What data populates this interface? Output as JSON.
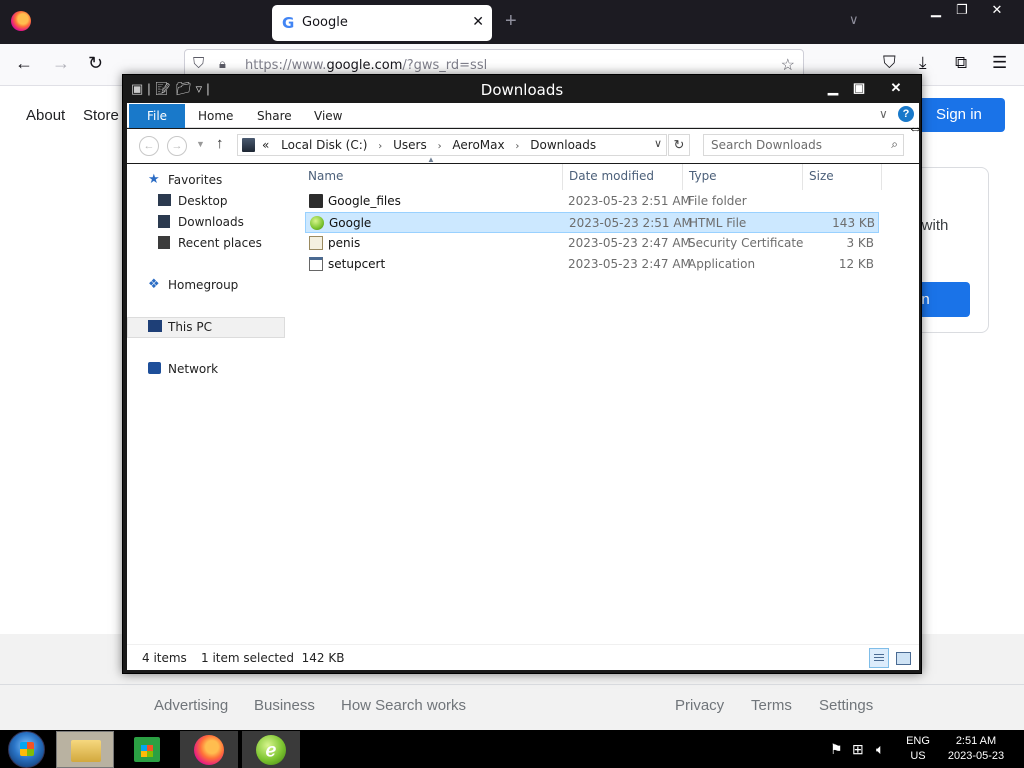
{
  "browser": {
    "tab_title": "Google",
    "url_prefix": "https://www.",
    "url_domain": "google.com",
    "url_path": "/?gws_rd=ssl",
    "icons": [
      "firefox-logo",
      "google-favicon",
      "close-icon",
      "plus-icon",
      "chevron-down-icon",
      "back-icon",
      "forward-icon",
      "reload-icon",
      "shield-icon",
      "lock-icon",
      "star-icon",
      "pocket-icon",
      "download-icon",
      "extensions-icon",
      "menu-icon"
    ]
  },
  "google": {
    "about": "About",
    "store": "Store",
    "signin_top": "Sign in",
    "card_text": "y with",
    "card_button": "in",
    "footer_links": [
      "Advertising",
      "Business",
      "How Search works",
      "Privacy",
      "Terms",
      "Settings"
    ]
  },
  "explorer": {
    "title": "Downloads",
    "ribbon": {
      "file": "File",
      "home": "Home",
      "share": "Share",
      "view": "View"
    },
    "address": {
      "overflow": "«",
      "crumbs": [
        "Local Disk (C:)",
        "Users",
        "AeroMax",
        "Downloads"
      ]
    },
    "search_placeholder": "Search Downloads",
    "nav": {
      "favorites": "Favorites",
      "desktop": "Desktop",
      "downloads": "Downloads",
      "recent": "Recent places",
      "homegroup": "Homegroup",
      "thispc": "This PC",
      "network": "Network"
    },
    "columns": {
      "name": "Name",
      "date": "Date modified",
      "type": "Type",
      "size": "Size"
    },
    "files": [
      {
        "name": "Google_files",
        "date": "2023-05-23 2:51 AM",
        "type": "File folder",
        "size": "",
        "icon": "folder-icon",
        "selected": false
      },
      {
        "name": "Google",
        "date": "2023-05-23 2:51 AM",
        "type": "HTML File",
        "size": "143 KB",
        "icon": "html-file-icon",
        "selected": true
      },
      {
        "name": "penis",
        "date": "2023-05-23 2:47 AM",
        "type": "Security Certificate",
        "size": "3 KB",
        "icon": "certificate-icon",
        "selected": false
      },
      {
        "name": "setupcert",
        "date": "2023-05-23 2:47 AM",
        "type": "Application",
        "size": "12 KB",
        "icon": "application-icon",
        "selected": false
      }
    ],
    "status": {
      "count": "4 items",
      "selection": "1 item selected  142 KB"
    }
  },
  "taskbar": {
    "apps": [
      "start-button",
      "file-explorer",
      "store",
      "firefox",
      "html-app"
    ],
    "lang_line1": "ENG",
    "lang_line2": "US",
    "time": "2:51 AM",
    "date": "2023-05-23"
  }
}
